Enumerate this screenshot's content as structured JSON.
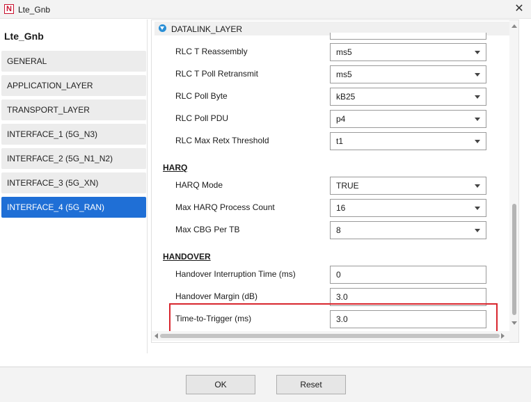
{
  "window": {
    "title": "Lte_Gnb",
    "app_icon_glyph": "N"
  },
  "sidebar": {
    "title": "Lte_Gnb",
    "items": [
      {
        "label": "GENERAL"
      },
      {
        "label": "APPLICATION_LAYER"
      },
      {
        "label": "TRANSPORT_LAYER"
      },
      {
        "label": "INTERFACE_1 (5G_N3)"
      },
      {
        "label": "INTERFACE_2 (5G_N1_N2)"
      },
      {
        "label": "INTERFACE_3 (5G_XN)"
      },
      {
        "label": "INTERFACE_4 (5G_RAN)",
        "selected": true
      }
    ]
  },
  "content": {
    "section_title": "DATALINK_LAYER",
    "rlc_rows": [
      {
        "label": "RLC T Reassembly",
        "value": "ms5"
      },
      {
        "label": "RLC T Poll Retransmit",
        "value": "ms5"
      },
      {
        "label": "RLC Poll Byte",
        "value": "kB25"
      },
      {
        "label": "RLC Poll PDU",
        "value": "p4"
      },
      {
        "label": "RLC Max Retx Threshold",
        "value": "t1"
      }
    ],
    "harq": {
      "title": "HARQ",
      "rows": [
        {
          "label": "HARQ Mode",
          "value": "TRUE"
        },
        {
          "label": "Max HARQ Process Count",
          "value": "16"
        },
        {
          "label": "Max CBG Per TB",
          "value": "8"
        }
      ]
    },
    "handover": {
      "title": "HANDOVER",
      "rows": [
        {
          "label": "Handover Interruption Time (ms)",
          "value": "0"
        },
        {
          "label": "Handover Margin (dB)",
          "value": "3.0"
        },
        {
          "label": "Time-to-Trigger (ms)",
          "value": "3.0"
        }
      ]
    }
  },
  "footer": {
    "ok_label": "OK",
    "reset_label": "Reset"
  },
  "colors": {
    "accent": "#1f6fd6",
    "highlight": "#d8262e"
  },
  "icons": {
    "close": "close-icon",
    "collapse": "collapse-triangle-icon",
    "dropdown": "chevron-down-icon"
  }
}
